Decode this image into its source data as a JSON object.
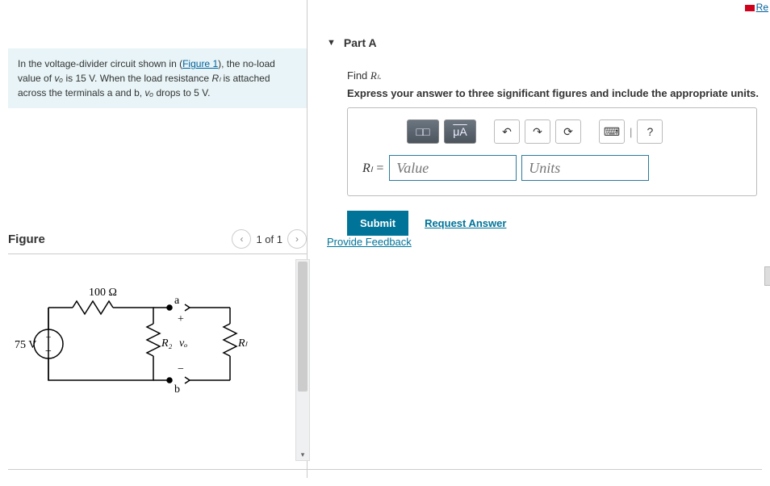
{
  "header": {
    "topRightLink": "Re"
  },
  "problem": {
    "text_before_link": "In the voltage-divider circuit shown in (",
    "figure_link": "Figure 1",
    "text_after_link": "), the no-load value of ",
    "vo": "vₒ",
    "text2": " is 15 V. When the load resistance ",
    "RL": "Rₗ",
    "text3": " is attached across the terminals a and b, ",
    "text4": " drops to 5 V."
  },
  "figure": {
    "title": "Figure",
    "pager": "1 of 1",
    "labels": {
      "r100": "100 Ω",
      "vsrc": "75 V",
      "R2": "R₂",
      "vo": "vₒ",
      "RL": "Rₗ",
      "a": "a",
      "b": "b",
      "plus": "+",
      "minus": "−"
    }
  },
  "partA": {
    "label": "Part A",
    "promptLine1_pre": "Find ",
    "promptLine1_var": "Rₗ",
    "promptLine1_post": ".",
    "promptLine2": "Express your answer to three significant figures and include the appropriate units.",
    "toolbar": {
      "templates": "□□",
      "units": "μA",
      "undo": "↶",
      "redo": "↷",
      "reset": "⟳",
      "keyboard": "⌨",
      "help": "?"
    },
    "varLabel": "Rₗ =",
    "valuePlaceholder": "Value",
    "unitsPlaceholder": "Units",
    "submit": "Submit",
    "requestAnswer": "Request Answer"
  },
  "feedback": "Provide Feedback"
}
